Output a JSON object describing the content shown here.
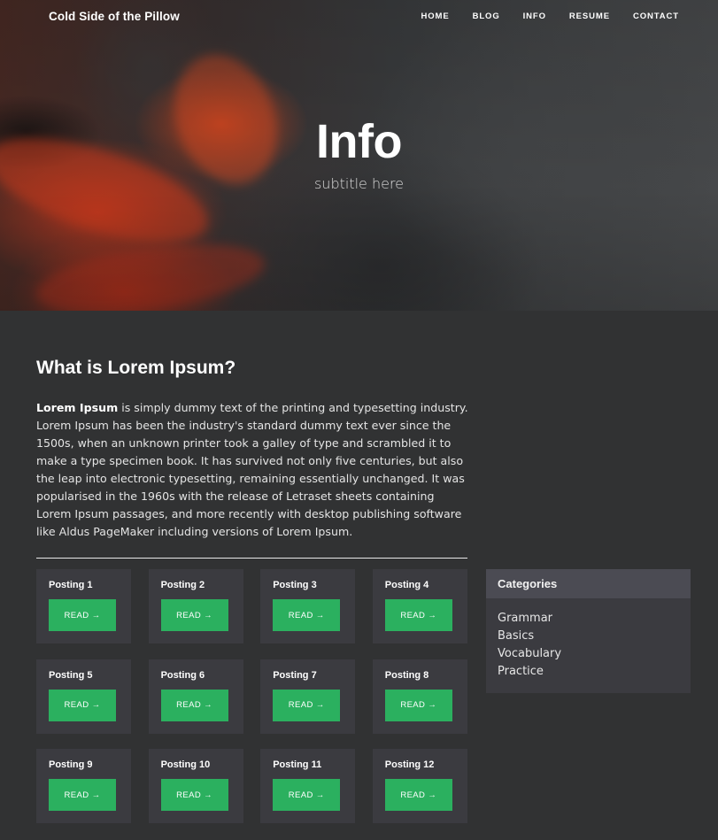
{
  "nav": {
    "brand": "Cold Side of the Pillow",
    "links": [
      "HOME",
      "BLOG",
      "INFO",
      "RESUME",
      "CONTACT"
    ]
  },
  "hero": {
    "title": "Info",
    "subtitle": "subtitle here"
  },
  "article": {
    "heading": "What is Lorem Ipsum?",
    "lead_bold": "Lorem Ipsum",
    "body": " is simply dummy text of the printing and typesetting industry. Lorem Ipsum has been the industry's standard dummy text ever since the 1500s, when an unknown printer took a galley of type and scrambled it to make a type specimen book. It has survived not only five centuries, but also the leap into electronic typesetting, remaining essentially unchanged. It was popularised in the 1960s with the release of Letraset sheets containing Lorem Ipsum passages, and more recently with desktop publishing software like Aldus PageMaker including versions of Lorem Ipsum."
  },
  "postings": [
    {
      "title": "Posting 1",
      "button": "READ →"
    },
    {
      "title": "Posting 2",
      "button": "READ →"
    },
    {
      "title": "Posting 3",
      "button": "READ →"
    },
    {
      "title": "Posting 4",
      "button": "READ →"
    },
    {
      "title": "Posting 5",
      "button": "READ →"
    },
    {
      "title": "Posting 6",
      "button": "READ →"
    },
    {
      "title": "Posting 7",
      "button": "READ →"
    },
    {
      "title": "Posting 8",
      "button": "READ →"
    },
    {
      "title": "Posting 9",
      "button": "READ →"
    },
    {
      "title": "Posting 10",
      "button": "READ →"
    },
    {
      "title": "Posting 11",
      "button": "READ →"
    },
    {
      "title": "Posting 12",
      "button": "READ →"
    }
  ],
  "sidebar": {
    "header": "Categories",
    "items": [
      "Grammar",
      "Basics",
      "Vocabulary",
      "Practice"
    ]
  },
  "colors": {
    "page_background": "#313233",
    "card_background": "#3b3b40",
    "sidebar_header": "#4b4b53",
    "button_green": "#2bb05f"
  }
}
